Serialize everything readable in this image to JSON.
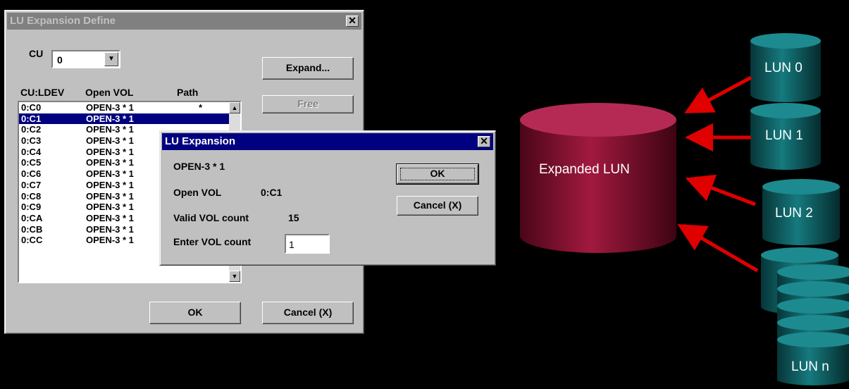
{
  "define_dialog": {
    "title": "LU Expansion Define",
    "close_glyph": "✕",
    "cu_label": "CU",
    "cu_value": "0",
    "expand_label": "Expand...",
    "free_label": "Free",
    "columns": [
      "CU:LDEV",
      "Open VOL",
      "Path"
    ],
    "rows": [
      {
        "ldev": "0:C0",
        "vol": "OPEN-3 * 1",
        "path": "*"
      },
      {
        "ldev": "0:C1",
        "vol": "OPEN-3 * 1",
        "path": ""
      },
      {
        "ldev": "0:C2",
        "vol": "OPEN-3 * 1",
        "path": ""
      },
      {
        "ldev": "0:C3",
        "vol": "OPEN-3 * 1",
        "path": ""
      },
      {
        "ldev": "0:C4",
        "vol": "OPEN-3 * 1",
        "path": ""
      },
      {
        "ldev": "0:C5",
        "vol": "OPEN-3 * 1",
        "path": ""
      },
      {
        "ldev": "0:C6",
        "vol": "OPEN-3 * 1",
        "path": ""
      },
      {
        "ldev": "0:C7",
        "vol": "OPEN-3 * 1",
        "path": ""
      },
      {
        "ldev": "0:C8",
        "vol": "OPEN-3 * 1",
        "path": ""
      },
      {
        "ldev": "0:C9",
        "vol": "OPEN-3 * 1",
        "path": ""
      },
      {
        "ldev": "0:CA",
        "vol": "OPEN-3 * 1",
        "path": ""
      },
      {
        "ldev": "0:CB",
        "vol": "OPEN-3 * 1",
        "path": ""
      },
      {
        "ldev": "0:CC",
        "vol": "OPEN-3 * 1",
        "path": ""
      }
    ],
    "selected_row": "0:C1",
    "ok_label": "OK",
    "cancel_label": "Cancel (X)"
  },
  "expansion_dialog": {
    "title": "LU Expansion",
    "close_glyph": "✕",
    "volume": "OPEN-3 * 1",
    "open_vol_label": "Open VOL",
    "open_vol_value": "0:C1",
    "valid_count_label": "Valid VOL count",
    "valid_count_value": "15",
    "enter_count_label": "Enter VOL count",
    "enter_count_value": "1",
    "ok_label": "OK",
    "cancel_label": "Cancel (X)"
  },
  "diagram": {
    "expanded_label": "Expanded LUN",
    "luns": [
      "LUN 0",
      "LUN 1",
      "LUN 2",
      "LUN n"
    ],
    "colors": {
      "expanded": "#8b1438",
      "lun": "#0f5c5f",
      "arrow": "#e00000"
    }
  }
}
